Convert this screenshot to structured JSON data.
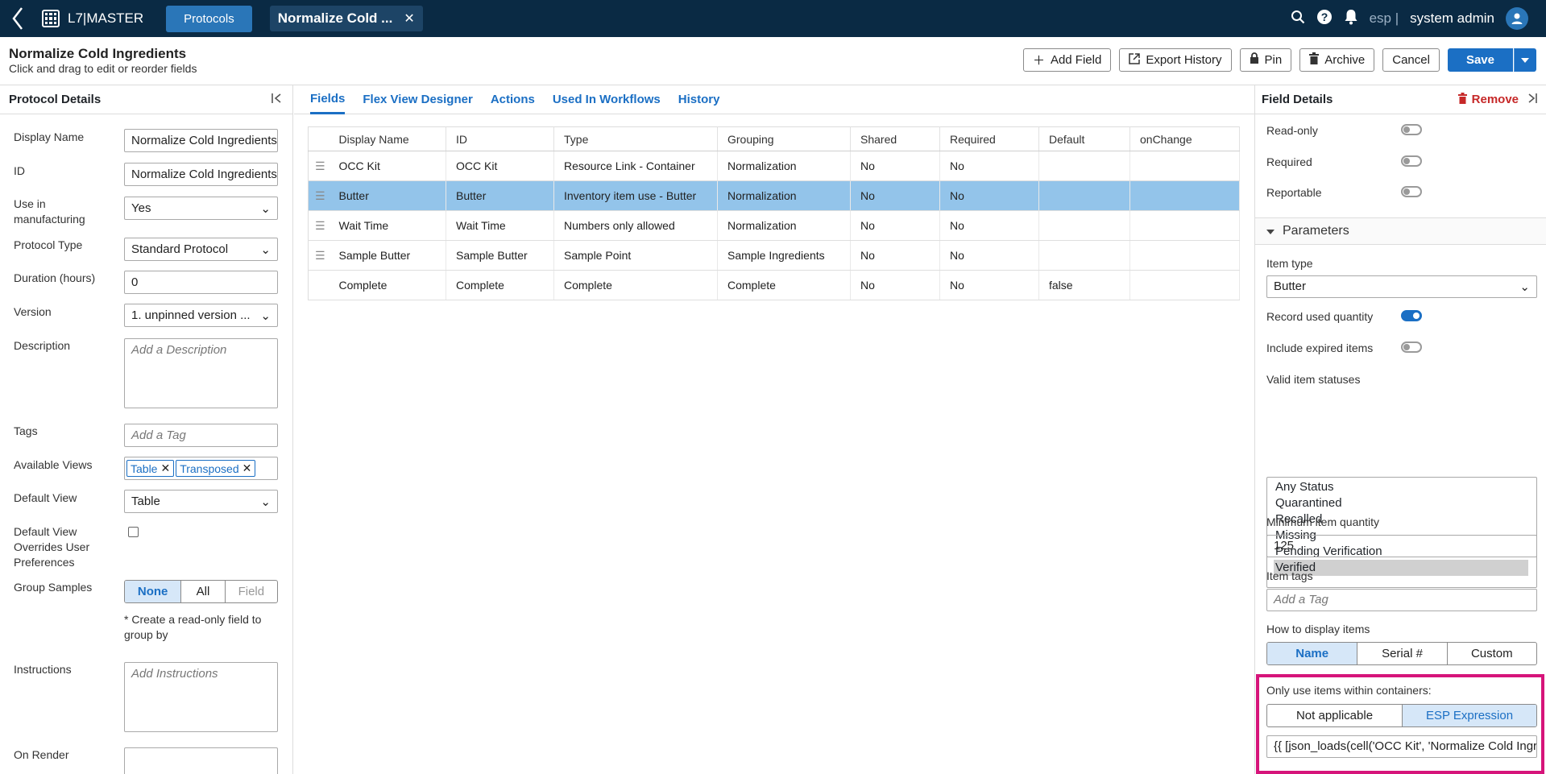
{
  "topbar": {
    "app_name": "L7|MASTER",
    "nav_button": "Protocols",
    "open_tab": "Normalize Cold ...",
    "lang": "esp |",
    "user": "system admin"
  },
  "header": {
    "title": "Normalize Cold Ingredients",
    "subtitle": "Click and drag to edit or reorder fields",
    "buttons": {
      "add_field": "Add Field",
      "export_history": "Export History",
      "pin": "Pin",
      "archive": "Archive",
      "cancel": "Cancel",
      "save": "Save"
    }
  },
  "left_panel": {
    "title": "Protocol Details",
    "display_name_label": "Display Name",
    "display_name_value": "Normalize Cold Ingredients",
    "id_label": "ID",
    "id_value": "Normalize Cold Ingredients",
    "use_in_mfg_label": "Use in manufacturing",
    "use_in_mfg_value": "Yes",
    "protocol_type_label": "Protocol Type",
    "protocol_type_value": "Standard Protocol",
    "duration_label": "Duration (hours)",
    "duration_value": "0",
    "version_label": "Version",
    "version_value": "1. unpinned version ...",
    "description_label": "Description",
    "description_placeholder": "Add a Description",
    "tags_label": "Tags",
    "tags_placeholder": "Add a Tag",
    "available_views_label": "Available Views",
    "views": [
      "Table",
      "Transposed"
    ],
    "default_view_label": "Default View",
    "default_view_value": "Table",
    "override_label": "Default View Overrides User Preferences",
    "group_samples_label": "Group Samples",
    "group_options": [
      "None",
      "All",
      "Field"
    ],
    "group_note": "* Create a read-only field to group by",
    "instructions_label": "Instructions",
    "instructions_placeholder": "Add Instructions",
    "on_render_label": "On Render"
  },
  "center": {
    "tabs": [
      "Fields",
      "Flex View Designer",
      "Actions",
      "Used In Workflows",
      "History"
    ],
    "columns": [
      "Display Name",
      "ID",
      "Type",
      "Grouping",
      "Shared",
      "Required",
      "Default",
      "onChange"
    ],
    "rows": [
      [
        "OCC Kit",
        "OCC Kit",
        "Resource Link - Container",
        "Normalization",
        "No",
        "No",
        "",
        ""
      ],
      [
        "Butter",
        "Butter",
        "Inventory item use - Butter",
        "Normalization",
        "No",
        "No",
        "",
        ""
      ],
      [
        "Wait Time",
        "Wait Time",
        "Numbers only allowed",
        "Normalization",
        "No",
        "No",
        "",
        ""
      ],
      [
        "Sample Butter",
        "Sample Butter",
        "Sample Point",
        "Sample Ingredients",
        "No",
        "No",
        "",
        ""
      ],
      [
        "Complete",
        "Complete",
        "Complete",
        "Complete",
        "No",
        "No",
        "false",
        ""
      ]
    ]
  },
  "right_panel": {
    "title": "Field Details",
    "remove": "Remove",
    "read_only": "Read-only",
    "required": "Required",
    "reportable": "Reportable",
    "parameters": "Parameters",
    "item_type_label": "Item type",
    "item_type_value": "Butter",
    "record_used_label": "Record used quantity",
    "include_expired_label": "Include expired items",
    "valid_statuses_label": "Valid item statuses",
    "statuses": [
      "Any Status",
      "Quarantined",
      "Recalled",
      "Missing",
      "Pending Verification",
      "Verified"
    ],
    "min_qty_label": "Minimum item quantity",
    "min_qty_value": "125",
    "item_tags_label": "Item tags",
    "item_tags_placeholder": "Add a Tag",
    "display_items_label": "How to display items",
    "display_options": [
      "Name",
      "Serial #",
      "Custom"
    ],
    "containers_label": "Only use items within containers:",
    "container_options": [
      "Not applicable",
      "ESP Expression"
    ],
    "expression_value": "{{ [json_loads(cell('OCC Kit', 'Normalize Cold Ingredients'"
  },
  "colors": {
    "topbar": "#0a2a44",
    "accent": "#1b6fc4",
    "selected_row": "#93c4ea",
    "highlight": "#d6147a",
    "remove": "#c62828"
  }
}
